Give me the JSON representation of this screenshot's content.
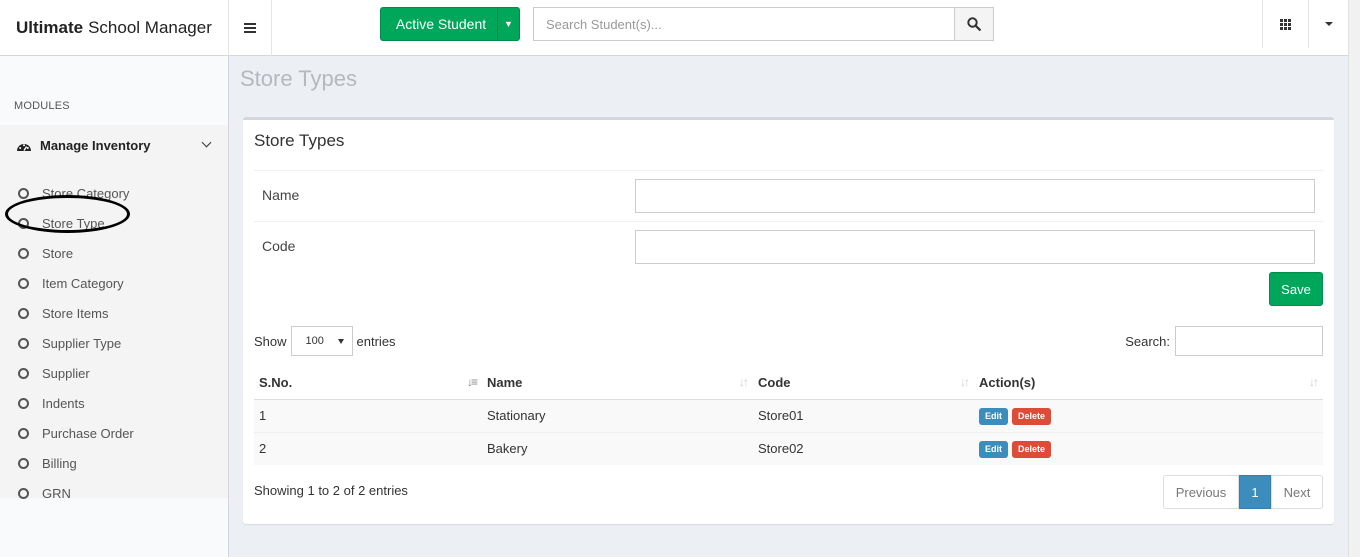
{
  "app": {
    "title_bold": "Ultimate",
    "title_rest": "School Manager"
  },
  "topbar": {
    "active_student_label": "Active Student",
    "search_placeholder": "Search Student(s)..."
  },
  "sidebar": {
    "section_header": "MODULES",
    "parent_label": "Manage Inventory",
    "items": [
      {
        "label": "Store Category"
      },
      {
        "label": "Store Type"
      },
      {
        "label": "Store"
      },
      {
        "label": "Item Category"
      },
      {
        "label": "Store Items"
      },
      {
        "label": "Supplier Type"
      },
      {
        "label": "Supplier"
      },
      {
        "label": "Indents"
      },
      {
        "label": "Purchase Order"
      },
      {
        "label": "Billing"
      },
      {
        "label": "GRN"
      }
    ]
  },
  "page": {
    "title": "Store Types"
  },
  "form": {
    "box_title": "Store Types",
    "name_label": "Name",
    "name_value": "",
    "code_label": "Code",
    "code_value": "",
    "save_label": "Save"
  },
  "table": {
    "show_label": "Show",
    "page_length": "100",
    "entries_label": "entries",
    "search_label": "Search:",
    "columns": [
      "S.No.",
      "Name",
      "Code",
      "Action(s)"
    ],
    "rows": [
      {
        "sno": "1",
        "name": "Stationary",
        "code": "Store01",
        "edit": "Edit",
        "delete": "Delete"
      },
      {
        "sno": "2",
        "name": "Bakery",
        "code": "Store02",
        "edit": "Edit",
        "delete": "Delete"
      }
    ],
    "info": "Showing 1 to 2 of 2 entries",
    "pagination": {
      "previous": "Previous",
      "current": "1",
      "next": "Next"
    }
  },
  "colors": {
    "green": "#00a65a",
    "blue": "#3c8dbc",
    "red": "#dd4b39"
  }
}
